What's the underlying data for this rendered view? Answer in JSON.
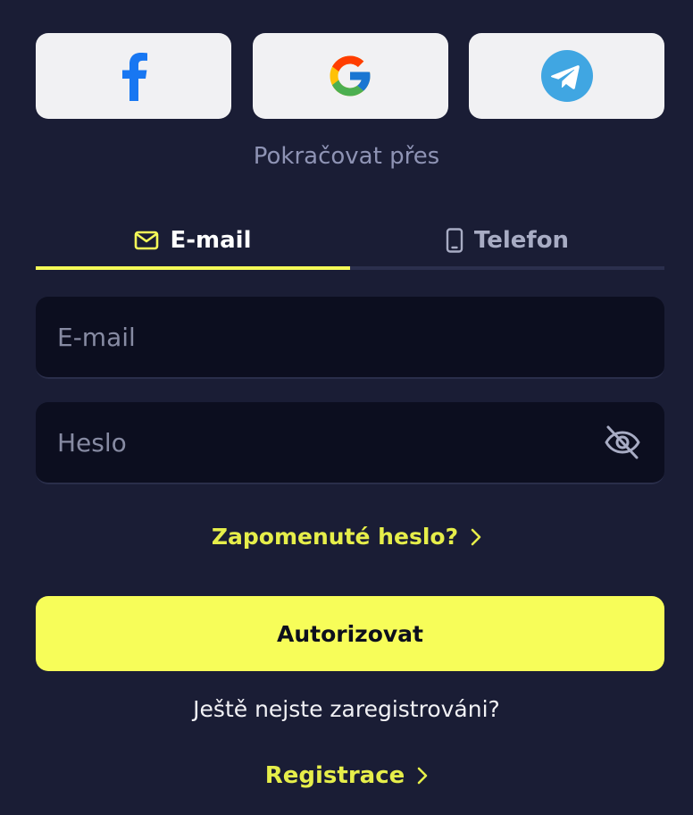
{
  "social": {
    "buttons": [
      {
        "name": "facebook",
        "icon": "facebook-icon",
        "color": "#1877f2"
      },
      {
        "name": "google",
        "icon": "google-icon"
      },
      {
        "name": "telegram",
        "icon": "telegram-icon",
        "color": "#40a6e2"
      }
    ],
    "continue_label": "Pokračovat přes"
  },
  "tabs": [
    {
      "label": "E-mail",
      "icon": "envelope-icon",
      "active": true
    },
    {
      "label": "Telefon",
      "icon": "phone-icon",
      "active": false
    }
  ],
  "form": {
    "email_placeholder": "E-mail",
    "password_placeholder": "Heslo",
    "forgot_link": "Zapomenuté heslo?",
    "submit_label": "Autorizovat"
  },
  "footer": {
    "not_registered": "Ještě nejste zaregistrováni?",
    "register_link": "Registrace"
  },
  "colors": {
    "background": "#1a1d35",
    "accent": "#f7fd59",
    "input_bg": "#0c0e1f"
  }
}
